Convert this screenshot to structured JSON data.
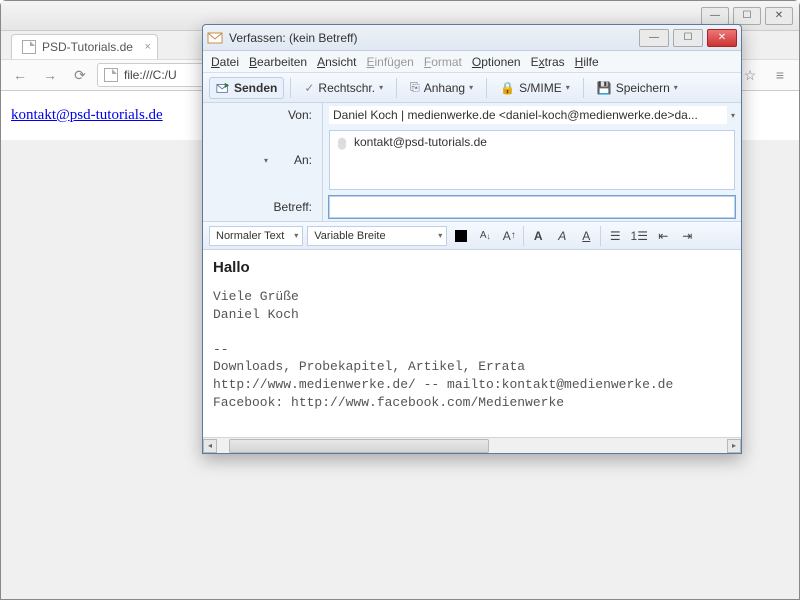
{
  "browser": {
    "tab_title": "PSD-Tutorials.de",
    "url": "file:///C:/U",
    "link_text": "kontakt@psd-tutorials.de"
  },
  "compose": {
    "title": "Verfassen: (kein Betreff)",
    "menu": {
      "datei": "Datei",
      "bearbeiten": "Bearbeiten",
      "ansicht": "Ansicht",
      "einfuegen": "Einfügen",
      "format": "Format",
      "optionen": "Optionen",
      "extras": "Extras",
      "hilfe": "Hilfe"
    },
    "toolbar": {
      "senden": "Senden",
      "rechtschr": "Rechtschr.",
      "anhang": "Anhang",
      "smime": "S/MIME",
      "speichern": "Speichern"
    },
    "labels": {
      "von": "Von:",
      "an": "An:",
      "betreff": "Betreff:"
    },
    "from_value": "Daniel Koch | medienwerke.de <daniel-koch@medienwerke.de>da...",
    "to_value": "kontakt@psd-tutorials.de",
    "subject_value": "",
    "format": {
      "style": "Normaler Text",
      "font": "Variable Breite"
    },
    "body": {
      "greeting": "Hallo",
      "line1": "Viele Grüße",
      "line2": "Daniel Koch",
      "sep": "--",
      "sig1": "Downloads, Probekapitel, Artikel, Errata",
      "sig2": "http://www.medienwerke.de/ -- mailto:kontakt@medienwerke.de",
      "sig3": "Facebook: http://www.facebook.com/Medienwerke"
    }
  }
}
